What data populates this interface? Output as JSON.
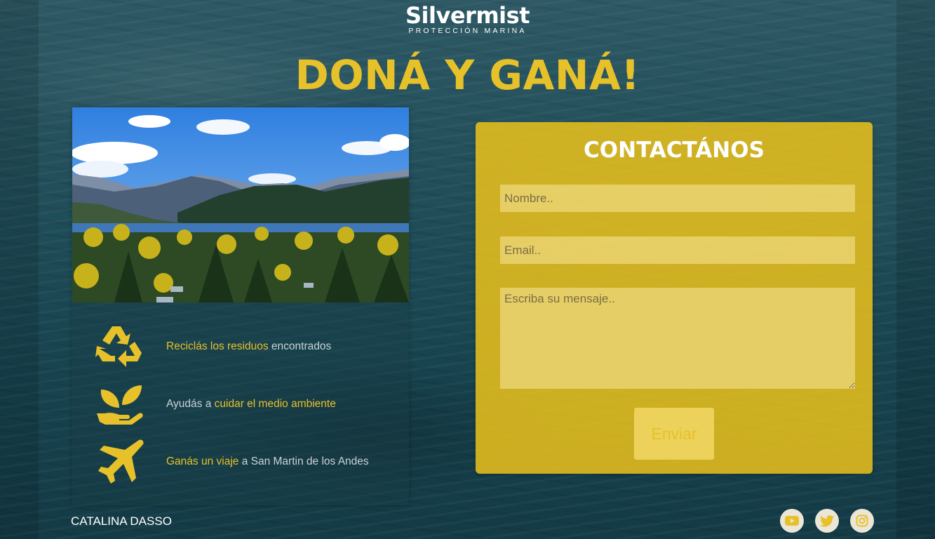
{
  "logo": {
    "name": "Silvermist",
    "tagline": "PROTECCIÓN MARINA"
  },
  "headline": "DONÁ Y GANÁ!",
  "benefits": [
    {
      "icon": "recycle-icon",
      "part1": "Reciclás los residuos",
      "part2": " encontrados"
    },
    {
      "icon": "leaf-hand-icon",
      "part1": "Ayudás a ",
      "part2": "cuidar el medio ambiente"
    },
    {
      "icon": "airplane-icon",
      "part1": "Ganás un viaje",
      "part2": " a San Martin de los Andes"
    }
  ],
  "contact": {
    "title": "CONTACTÁNOS",
    "name_placeholder": "Nombre..",
    "email_placeholder": "Email..",
    "message_placeholder": "Escriba su mensaje..",
    "send_label": "Enviar"
  },
  "footer": {
    "author": "CATALINA DASSO",
    "social": [
      "youtube-icon",
      "twitter-icon",
      "instagram-icon"
    ]
  },
  "colors": {
    "accent": "#e7c12a",
    "background": "#1f4d58",
    "panel": "#e7be1c"
  }
}
